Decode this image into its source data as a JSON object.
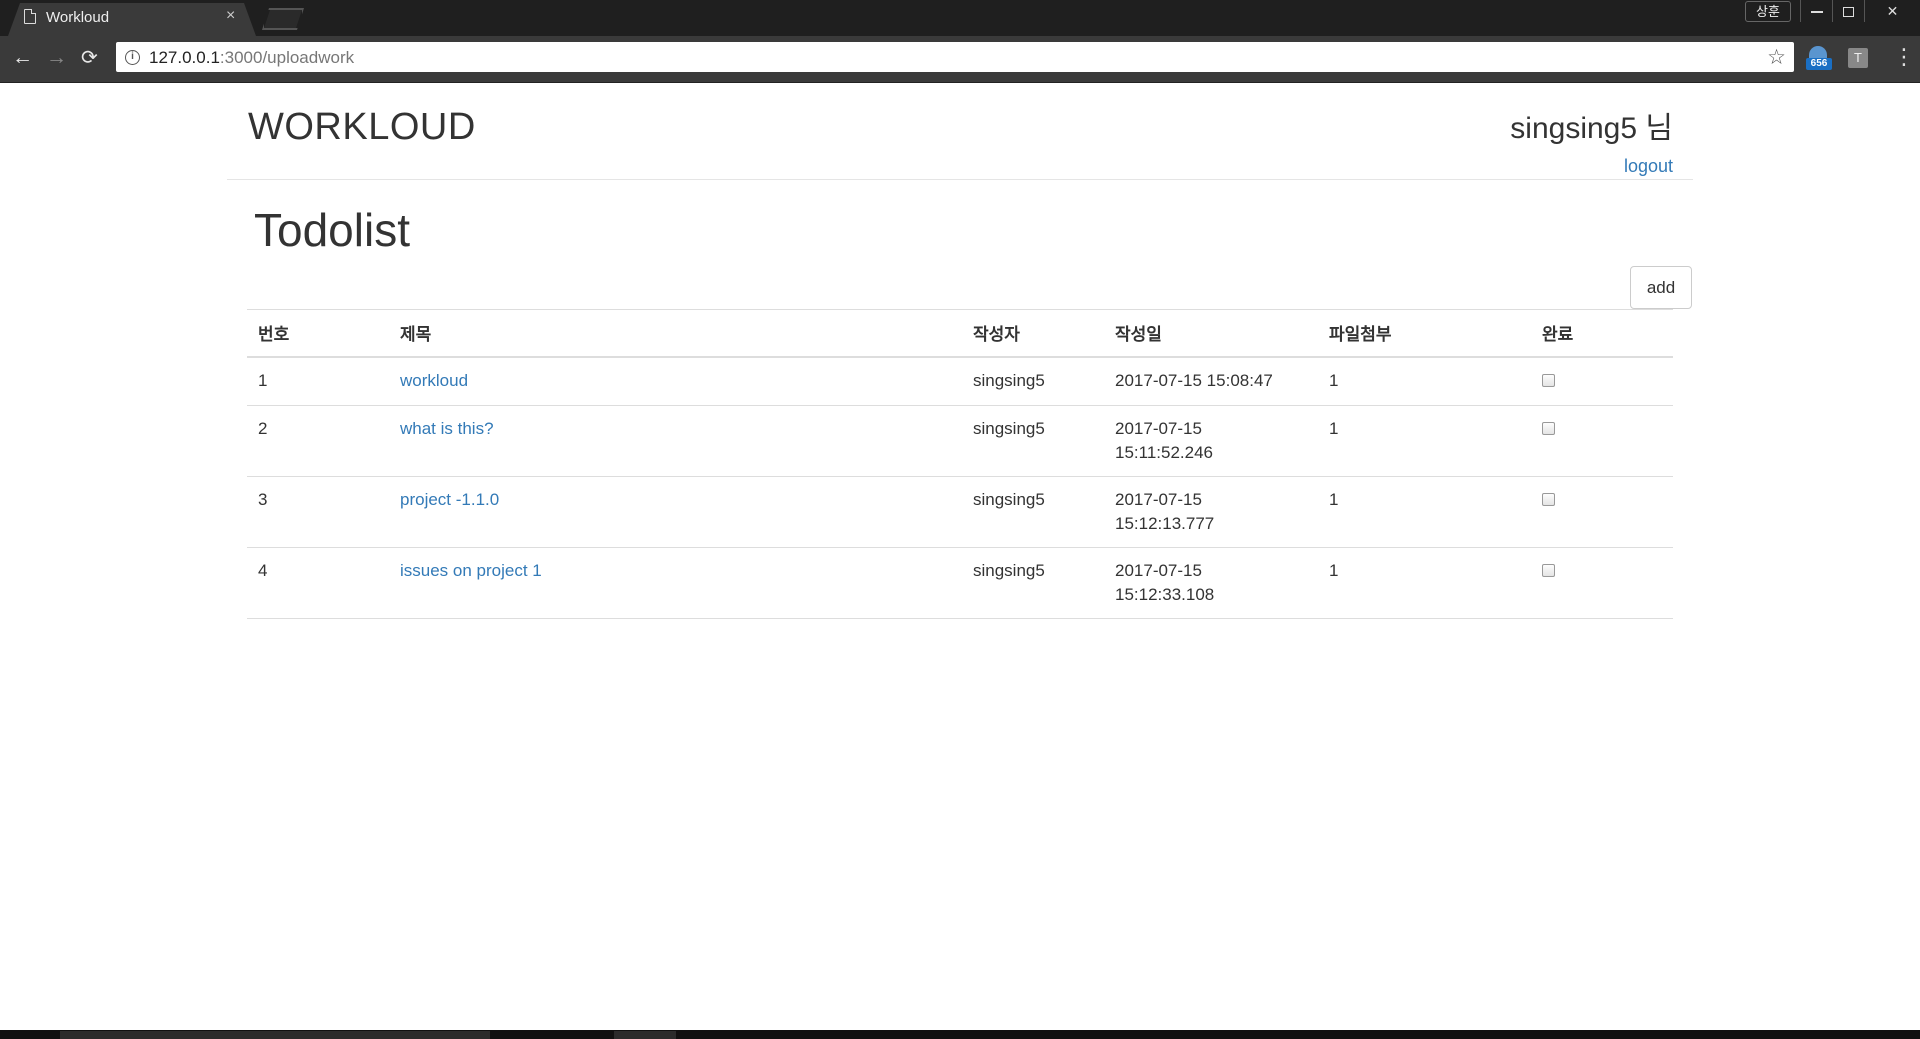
{
  "browser": {
    "tab_title": "Workloud",
    "tab_close": "×",
    "url_host": "127.0.0.1",
    "url_path": ":3000/uploadwork",
    "profile_label": "상훈",
    "extension_badge": "656",
    "extension_2_label": "T",
    "icons": {
      "back": "←",
      "forward": "→",
      "reload": "⟳",
      "info": "i",
      "star": "☆",
      "menu": "⋮",
      "close_window": "✕"
    }
  },
  "header": {
    "brand": "WORKLOUD",
    "user": "singsing5 님",
    "logout": "logout"
  },
  "main": {
    "title": "Todolist",
    "add_label": "add",
    "columns": [
      "번호",
      "제목",
      "작성자",
      "작성일",
      "파일첨부",
      "완료"
    ],
    "rows": [
      {
        "no": "1",
        "title": "workloud",
        "author": "singsing5",
        "date": "2017-07-15 15:08:47",
        "files": "1",
        "done": false
      },
      {
        "no": "2",
        "title": "what is this?",
        "author": "singsing5",
        "date": "2017-07-15 15:11:52.246",
        "files": "1",
        "done": false
      },
      {
        "no": "3",
        "title": "project -1.1.0",
        "author": "singsing5",
        "date": "2017-07-15 15:12:13.777",
        "files": "1",
        "done": false
      },
      {
        "no": "4",
        "title": "issues on project 1",
        "author": "singsing5",
        "date": "2017-07-15 15:12:33.108",
        "files": "1",
        "done": false
      }
    ]
  },
  "colors": {
    "link": "#337ab7",
    "chrome_dark": "#1f1f1f",
    "chrome_toolbar": "#3a3a3a"
  }
}
